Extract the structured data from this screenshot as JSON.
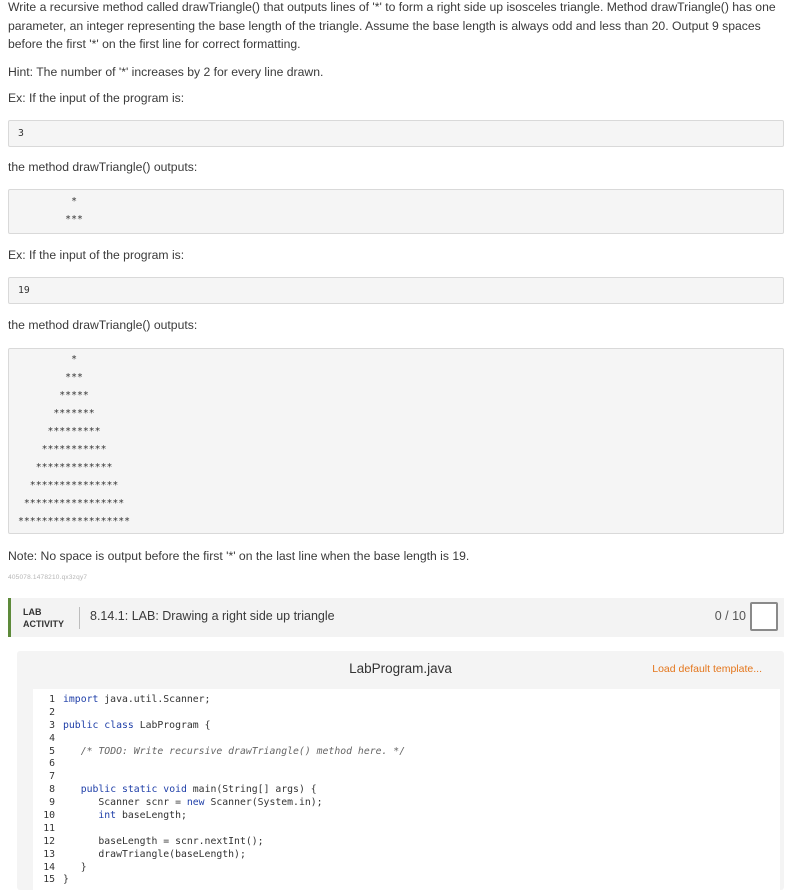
{
  "description": {
    "paragraph1": "Write a recursive method called drawTriangle() that outputs lines of '*' to form a right side up isosceles triangle. Method drawTriangle() has one parameter, an integer representing the base length of the triangle. Assume the base length is always odd and less than 20. Output 9 spaces before the first '*' on the first line for correct formatting.",
    "hint": "Hint: The number of '*' increases by 2 for every line drawn.",
    "ex1_label": "Ex: If the input of the program is:",
    "ex1_input": "3",
    "ex1_output_label": "the method drawTriangle() outputs:",
    "ex1_output": [
      "         *",
      "        ***"
    ],
    "ex2_label": "Ex: If the input of the program is:",
    "ex2_input": "19",
    "ex2_output_label": "the method drawTriangle() outputs:",
    "ex2_output": [
      "         *",
      "        ***",
      "       *****",
      "      *******",
      "     *********",
      "    ***********",
      "   *************",
      "  ***************",
      " *****************",
      "*******************"
    ],
    "note": "Note: No space is output before the first '*' on the last line when the base length is 19.",
    "id_code": "405078.1478210.qx3zqy7"
  },
  "lab": {
    "tag_line1": "LAB",
    "tag_line2": "ACTIVITY",
    "title": "8.14.1: LAB: Drawing a right side up triangle",
    "score": "0 / 10"
  },
  "editor": {
    "file_name": "LabProgram.java",
    "load_default": "Load default template...",
    "lines": [
      "import java.util.Scanner;",
      "",
      "public class LabProgram {",
      "",
      "   /* TODO: Write recursive drawTriangle() method here. */",
      "",
      "",
      "   public static void main(String[] args) {",
      "      Scanner scnr = new Scanner(System.in);",
      "      int baseLength;",
      "",
      "      baseLength = scnr.nextInt();",
      "      drawTriangle(baseLength);",
      "   }",
      "}"
    ]
  }
}
